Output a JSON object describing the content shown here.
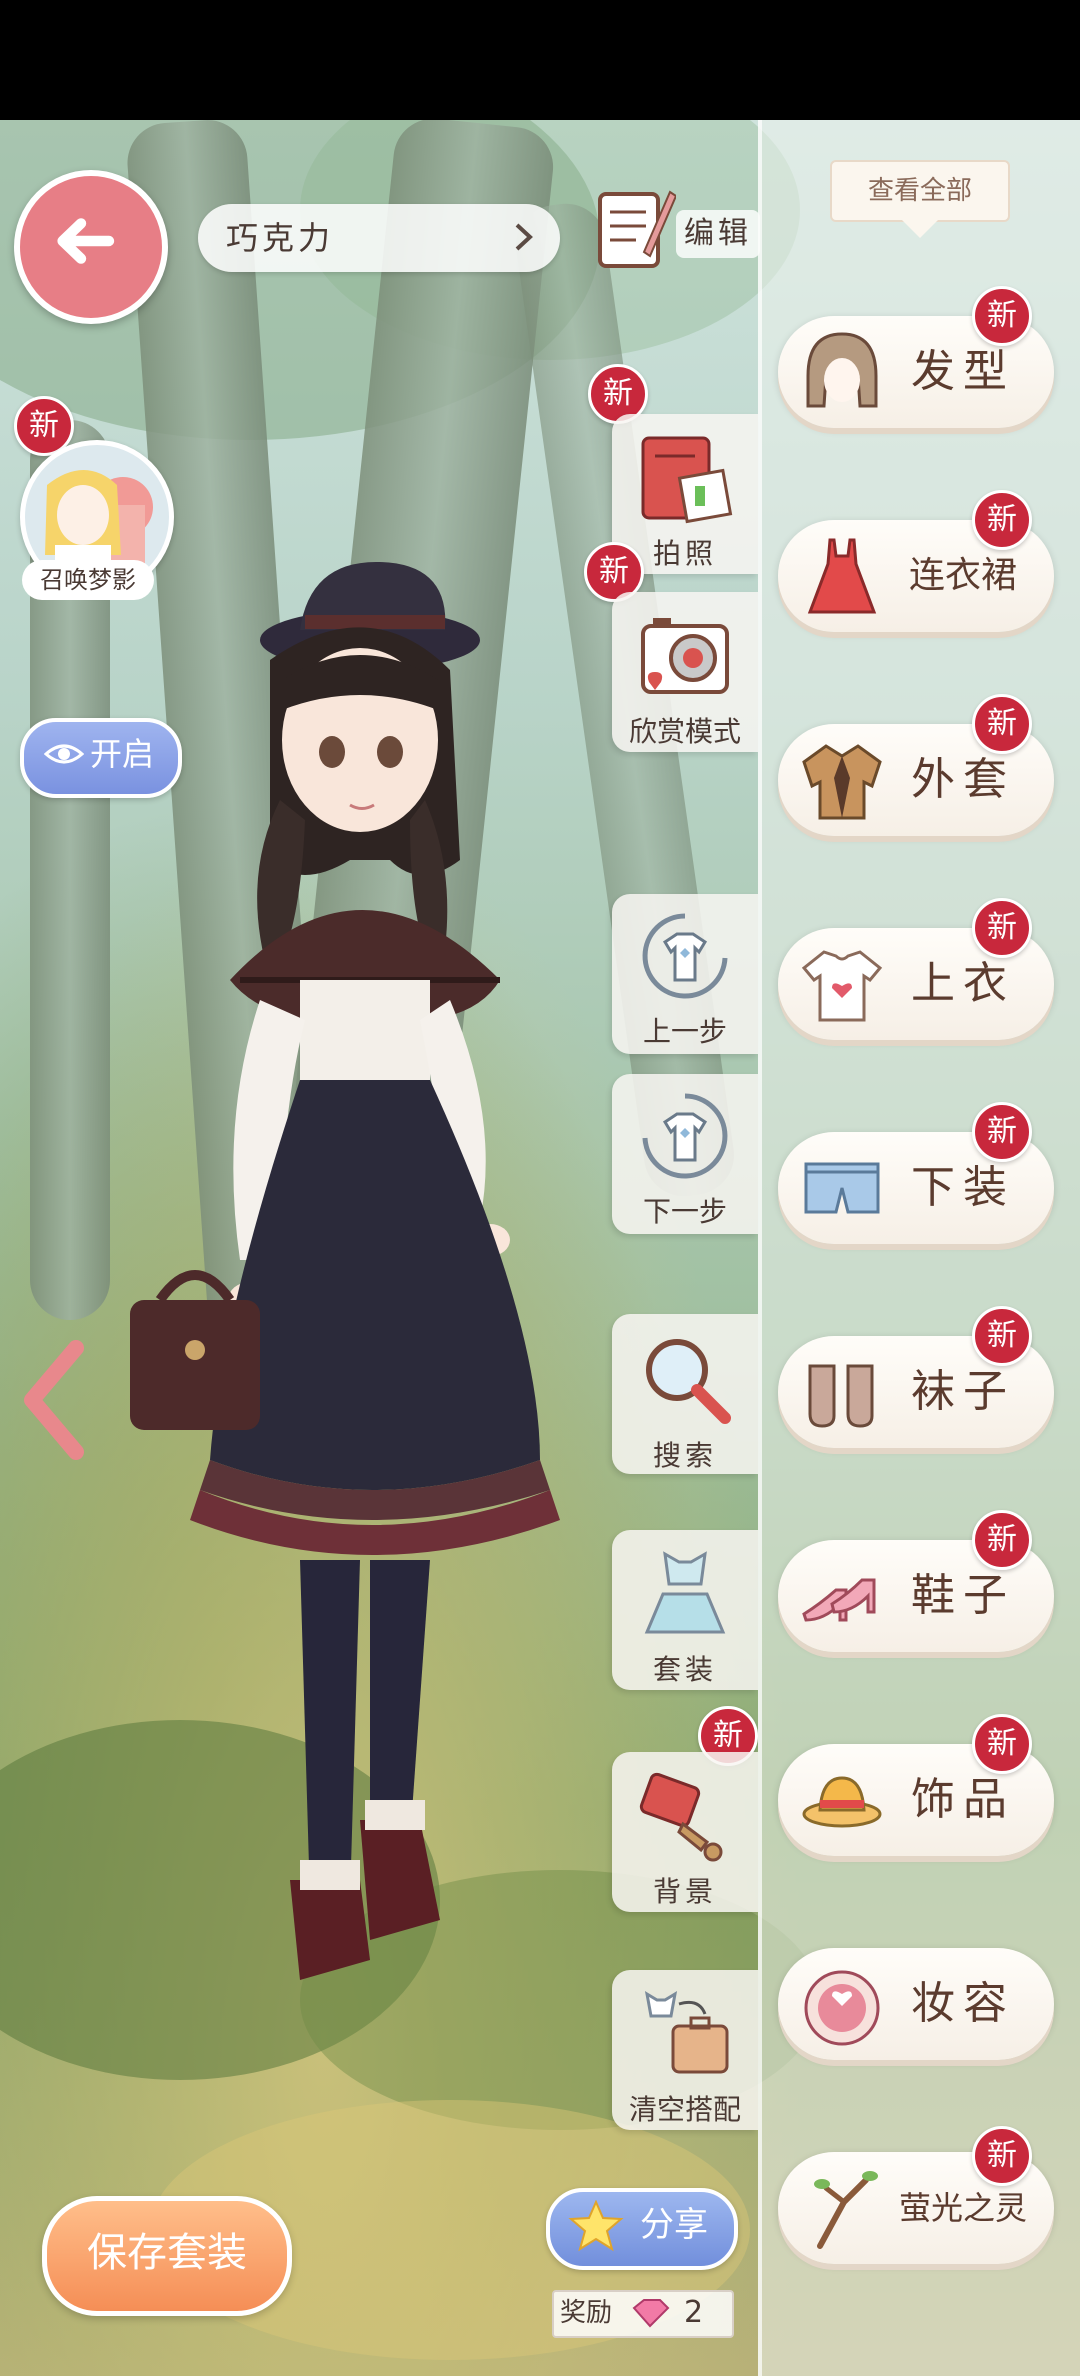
{
  "scene": {
    "outfit_name": "巧克力",
    "edit_label": "编辑",
    "summon_label": "召唤梦影",
    "open_label": "开启",
    "new_badge": "新"
  },
  "tools": {
    "photo": "拍照",
    "appreciate": "欣赏模式",
    "undo": "上一步",
    "redo": "下一步",
    "search": "搜索",
    "suit": "套装",
    "background": "背景",
    "clear": "清空搭配"
  },
  "categories": {
    "view_all": "查看全部",
    "items": [
      {
        "label": "发型",
        "new": true
      },
      {
        "label": "连衣裙",
        "new": true
      },
      {
        "label": "外套",
        "new": true
      },
      {
        "label": "上衣",
        "new": true
      },
      {
        "label": "下装",
        "new": true
      },
      {
        "label": "袜子",
        "new": true
      },
      {
        "label": "鞋子",
        "new": true
      },
      {
        "label": "饰品",
        "new": true
      },
      {
        "label": "妆容",
        "new": false
      },
      {
        "label": "萤光之灵",
        "new": true
      }
    ]
  },
  "bottom": {
    "save_label": "保存套装",
    "share_label": "分享",
    "reward_label": "奖励",
    "reward_count": "2"
  }
}
